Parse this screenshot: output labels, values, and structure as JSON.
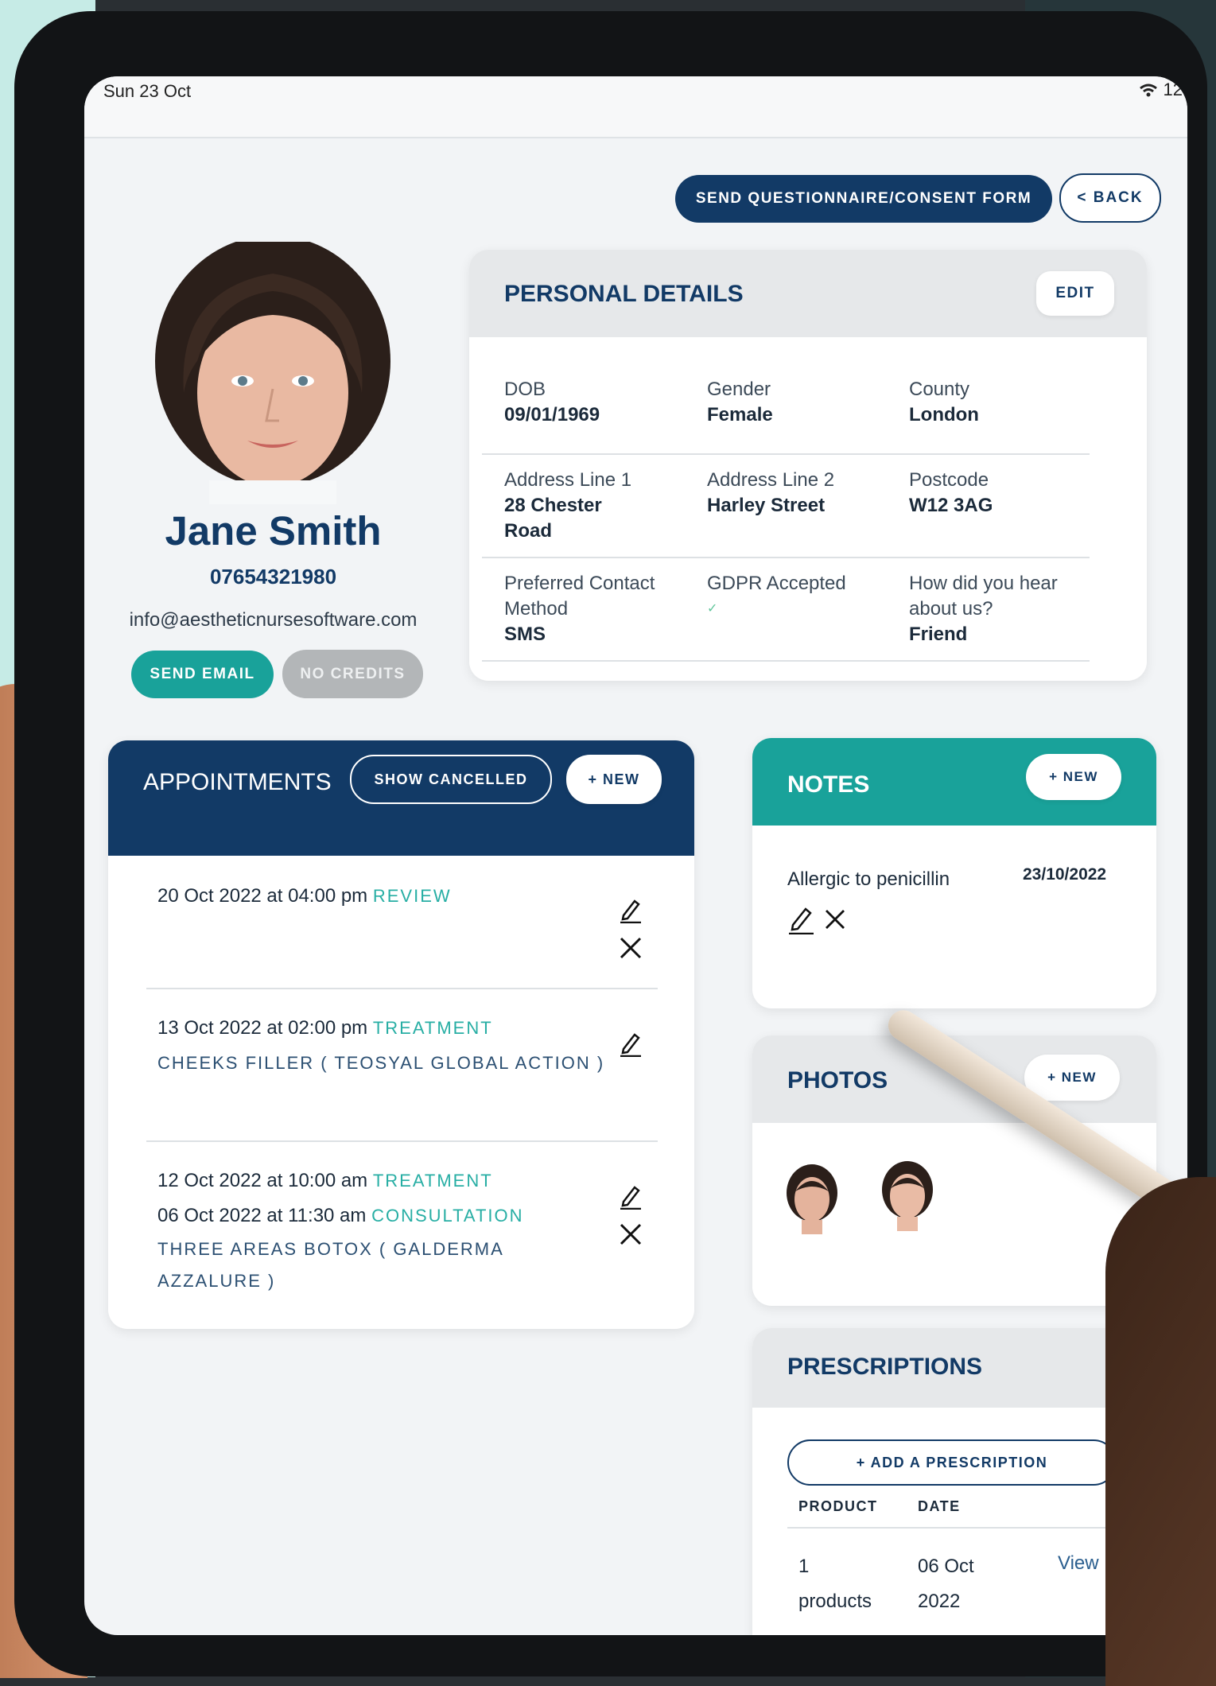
{
  "status_bar": {
    "date": "Sun 23 Oct",
    "time_partial": "12"
  },
  "toolbar": {
    "questionnaire_label": "SEND QUESTIONNAIRE/CONSENT FORM",
    "back_label": "< BACK"
  },
  "profile": {
    "name": "Jane Smith",
    "phone": "07654321980",
    "email": "info@aestheticnursesoftware.com",
    "send_email_label": "SEND EMAIL",
    "credits_label": "NO CREDITS"
  },
  "personal_details": {
    "title": "PERSONAL DETAILS",
    "edit_label": "EDIT",
    "fields": [
      {
        "label": "DOB",
        "value": "09/01/1969"
      },
      {
        "label": "Gender",
        "value": "Female"
      },
      {
        "label": "County",
        "value": "London"
      },
      {
        "label": "Address Line 1",
        "value": "28 Chester Road"
      },
      {
        "label": "Address Line 2",
        "value": "Harley Street"
      },
      {
        "label": "Postcode",
        "value": "W12 3AG"
      },
      {
        "label": "Preferred Contact Method",
        "value": "SMS"
      },
      {
        "label": "GDPR Accepted",
        "value": "✓"
      },
      {
        "label": "How did you hear about us?",
        "value": "Friend"
      }
    ]
  },
  "appointments": {
    "title": "APPOINTMENTS",
    "show_cancelled_label": "SHOW CANCELLED",
    "new_label": "+ NEW",
    "items": [
      {
        "datetime": "20 Oct 2022 at 04:00 pm",
        "type": "REVIEW"
      },
      {
        "datetime": "13 Oct 2022 at 02:00 pm",
        "type": "TREATMENT",
        "detail": "CHEEKS FILLER ( TEOSYAL GLOBAL ACTION )"
      },
      {
        "datetime": "12 Oct 2022 at 10:00 am",
        "type": "TREATMENT"
      },
      {
        "datetime": "06 Oct 2022 at 11:30 am",
        "type": "CONSULTATION",
        "detail": "THREE AREAS BOTOX ( GALDERMA AZZALURE )"
      }
    ]
  },
  "notes": {
    "title": "NOTES",
    "new_label": "+ NEW",
    "items": [
      {
        "text": "Allergic to penicillin",
        "date": "23/10/2022"
      }
    ]
  },
  "photos": {
    "title": "PHOTOS",
    "new_label": "+ NEW"
  },
  "prescriptions": {
    "title": "PRESCRIPTIONS",
    "add_label": "+ ADD A PRESCRIPTION",
    "columns": [
      "PRODUCT",
      "DATE"
    ],
    "rows": [
      {
        "product": "1 products",
        "date": "06 Oct 2022",
        "action": "View"
      }
    ]
  },
  "colors": {
    "navy": "#123a66",
    "teal": "#19a29a",
    "grey_button": "#b3b6b8",
    "background": "#f2f4f6"
  }
}
